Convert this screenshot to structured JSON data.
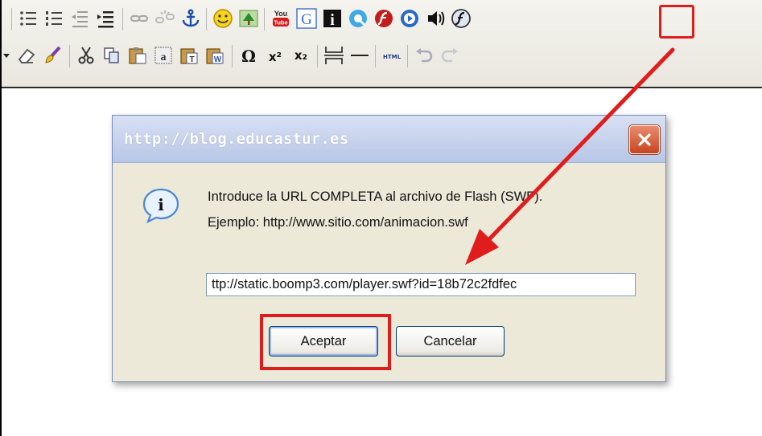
{
  "toolbar": {
    "row1_icons": [
      "bullet-list-icon",
      "numbered-list-icon",
      "outdent-icon",
      "indent-icon",
      "link-icon",
      "unlink-icon",
      "anchor-icon",
      "smiley-icon",
      "image-icon",
      "youtube-icon",
      "google-icon",
      "info-square-icon",
      "quicktime-icon",
      "flash-player-icon",
      "media-player-icon",
      "speaker-icon",
      "flash-icon"
    ],
    "row2_icons": [
      "eraser-icon",
      "brush-icon",
      "cut-icon",
      "copy-icon",
      "paste-icon",
      "paste-text-icon",
      "paste-plain-icon",
      "paste-word-icon",
      "omega-icon",
      "superscript-icon",
      "subscript-icon",
      "page-break-icon",
      "horizontal-rule-icon",
      "html-icon",
      "undo-icon",
      "redo-icon"
    ],
    "youtube_you": "You",
    "youtube_tube": "Tube",
    "google_letter": "G",
    "info_letter": "i",
    "omega": "Ω",
    "superscript": "x²",
    "subscript": "x₂",
    "html_label": "HTML"
  },
  "dialog": {
    "title": "http://blog.educastur.es",
    "message_line1": "Introduce la URL COMPLETA al archivo de Flash (SWF).",
    "message_line2": "Ejemplo: http://www.sitio.com/animacion.swf",
    "input_value": "ttp://static.boomp3.com/player.swf?id=18b72c2fdfec",
    "ok_label": "Aceptar",
    "cancel_label": "Cancelar",
    "info_letter": "i"
  },
  "colors": {
    "highlight": "#e01d1d",
    "title_gradient": "#b8c6e6",
    "dialog_bg": "#ece9d8",
    "close_button": "#c8441f"
  }
}
